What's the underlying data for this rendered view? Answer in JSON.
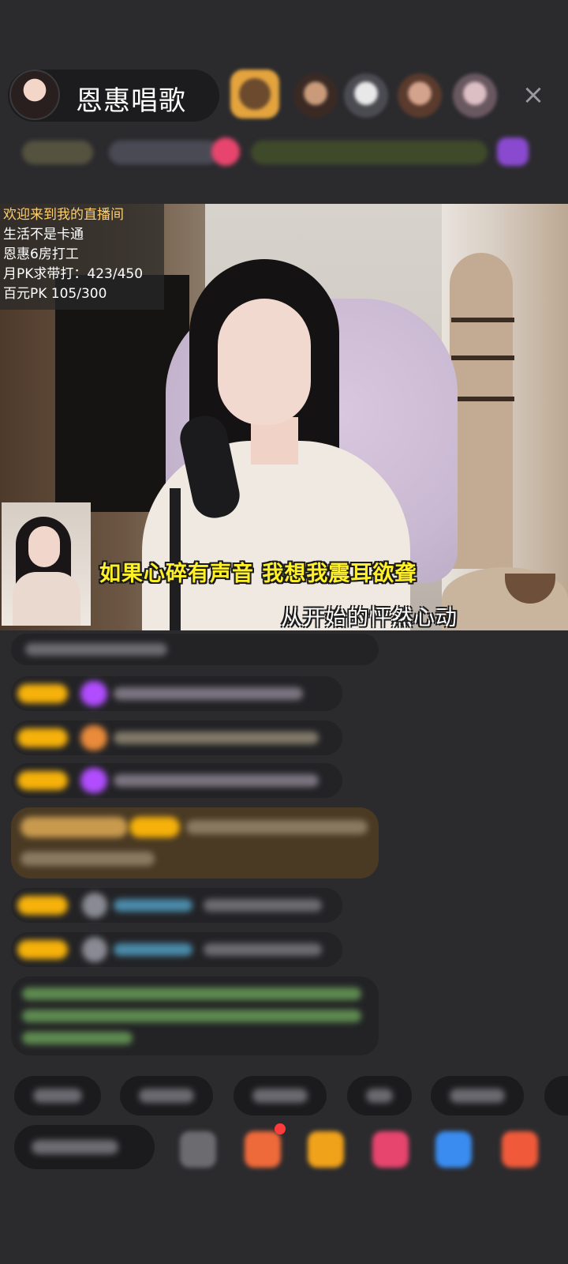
{
  "header": {
    "host_name": "恩惠唱歌",
    "close_icon": "×"
  },
  "stream": {
    "notice_lines": [
      "欢迎来到我的直播间",
      "生活不是卡通",
      "恩惠6房打工",
      "月PK求带打：423/450",
      "百元PK  105/300"
    ],
    "lyrics": {
      "line1": "如果心碎有声音  我想我震耳欲聋",
      "line2": "从开始的怦然心动"
    }
  },
  "colors": {
    "lyric_yellow": "#fff028",
    "notice_accent": "#ffcf6e",
    "badge_gold": "#f6b20a",
    "gem_purple": "#b14dff",
    "system_green": "#7ccf7c"
  }
}
